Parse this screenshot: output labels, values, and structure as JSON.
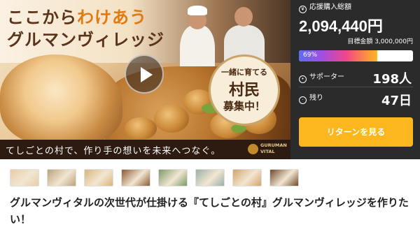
{
  "hero": {
    "title_line1_prefix": "ここから",
    "title_line1_accent": "わけあう",
    "title_line2": "グルマンヴィレッジ",
    "badge_line1": "一緒に育てる",
    "badge_line2": "村民",
    "badge_line3": "募集中！",
    "banner_text": "てしごとの村で、作り手の想いを未来へつなぐ。",
    "logo_line1": "GURUMAN",
    "logo_line2": "VITAL"
  },
  "stats": {
    "raised_label": "応援購入総額",
    "raised_amount": "2,094,440円",
    "goal_text": "目標金額 3,000,000円",
    "progress_percent": 69,
    "progress_label": "69%",
    "supporters_label": "サポーター",
    "supporters_value": "198人",
    "remaining_label": "残り",
    "remaining_value": "47日",
    "return_button_label": "リターンを見る",
    "colors": {
      "panel_bg": "#2b2b2b",
      "button_bg": "#fbb71d",
      "progress_start": "#5f6cf0",
      "progress_end": "#ffb81c"
    }
  },
  "thumbnails": [
    {
      "color": "#e8cda7"
    },
    {
      "color": "#b9a27a"
    },
    {
      "color": "#d8b67e"
    },
    {
      "color": "#8a5a33"
    },
    {
      "color": "#7a9a6a"
    },
    {
      "color": "#9ab0a8"
    },
    {
      "color": "#d2a56a"
    },
    {
      "color": "#6e4a2e"
    }
  ],
  "project": {
    "title": "グルマンヴィタルの次世代が仕掛ける『てしごとの村』グルマンヴィレッジを作りたい！"
  }
}
